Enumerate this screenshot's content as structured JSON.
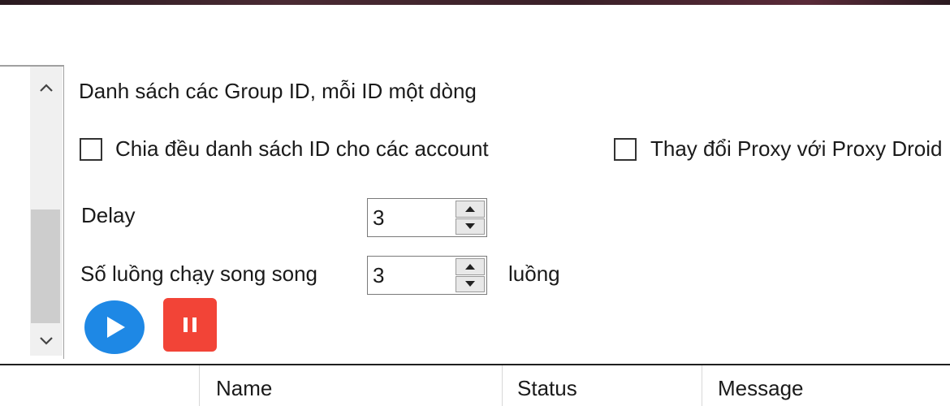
{
  "form": {
    "group_ids_label": "Danh sách các Group ID, mỗi ID một dòng",
    "split_ids_checkbox": {
      "label": "Chia đều danh sách ID cho các account",
      "checked": false
    },
    "proxy_droid_checkbox": {
      "label": "Thay đổi Proxy với Proxy Droid",
      "checked": false
    },
    "delay": {
      "label": "Delay",
      "value": "3"
    },
    "threads": {
      "label": "Số luồng chạy song song",
      "value": "3",
      "unit": "luồng"
    }
  },
  "actions": {
    "play_icon": "play-icon",
    "pause_icon": "pause-icon",
    "play_color": "#1e88e5",
    "pause_color": "#f24437"
  },
  "grid": {
    "columns": [
      "Name",
      "Status",
      "Message"
    ]
  }
}
